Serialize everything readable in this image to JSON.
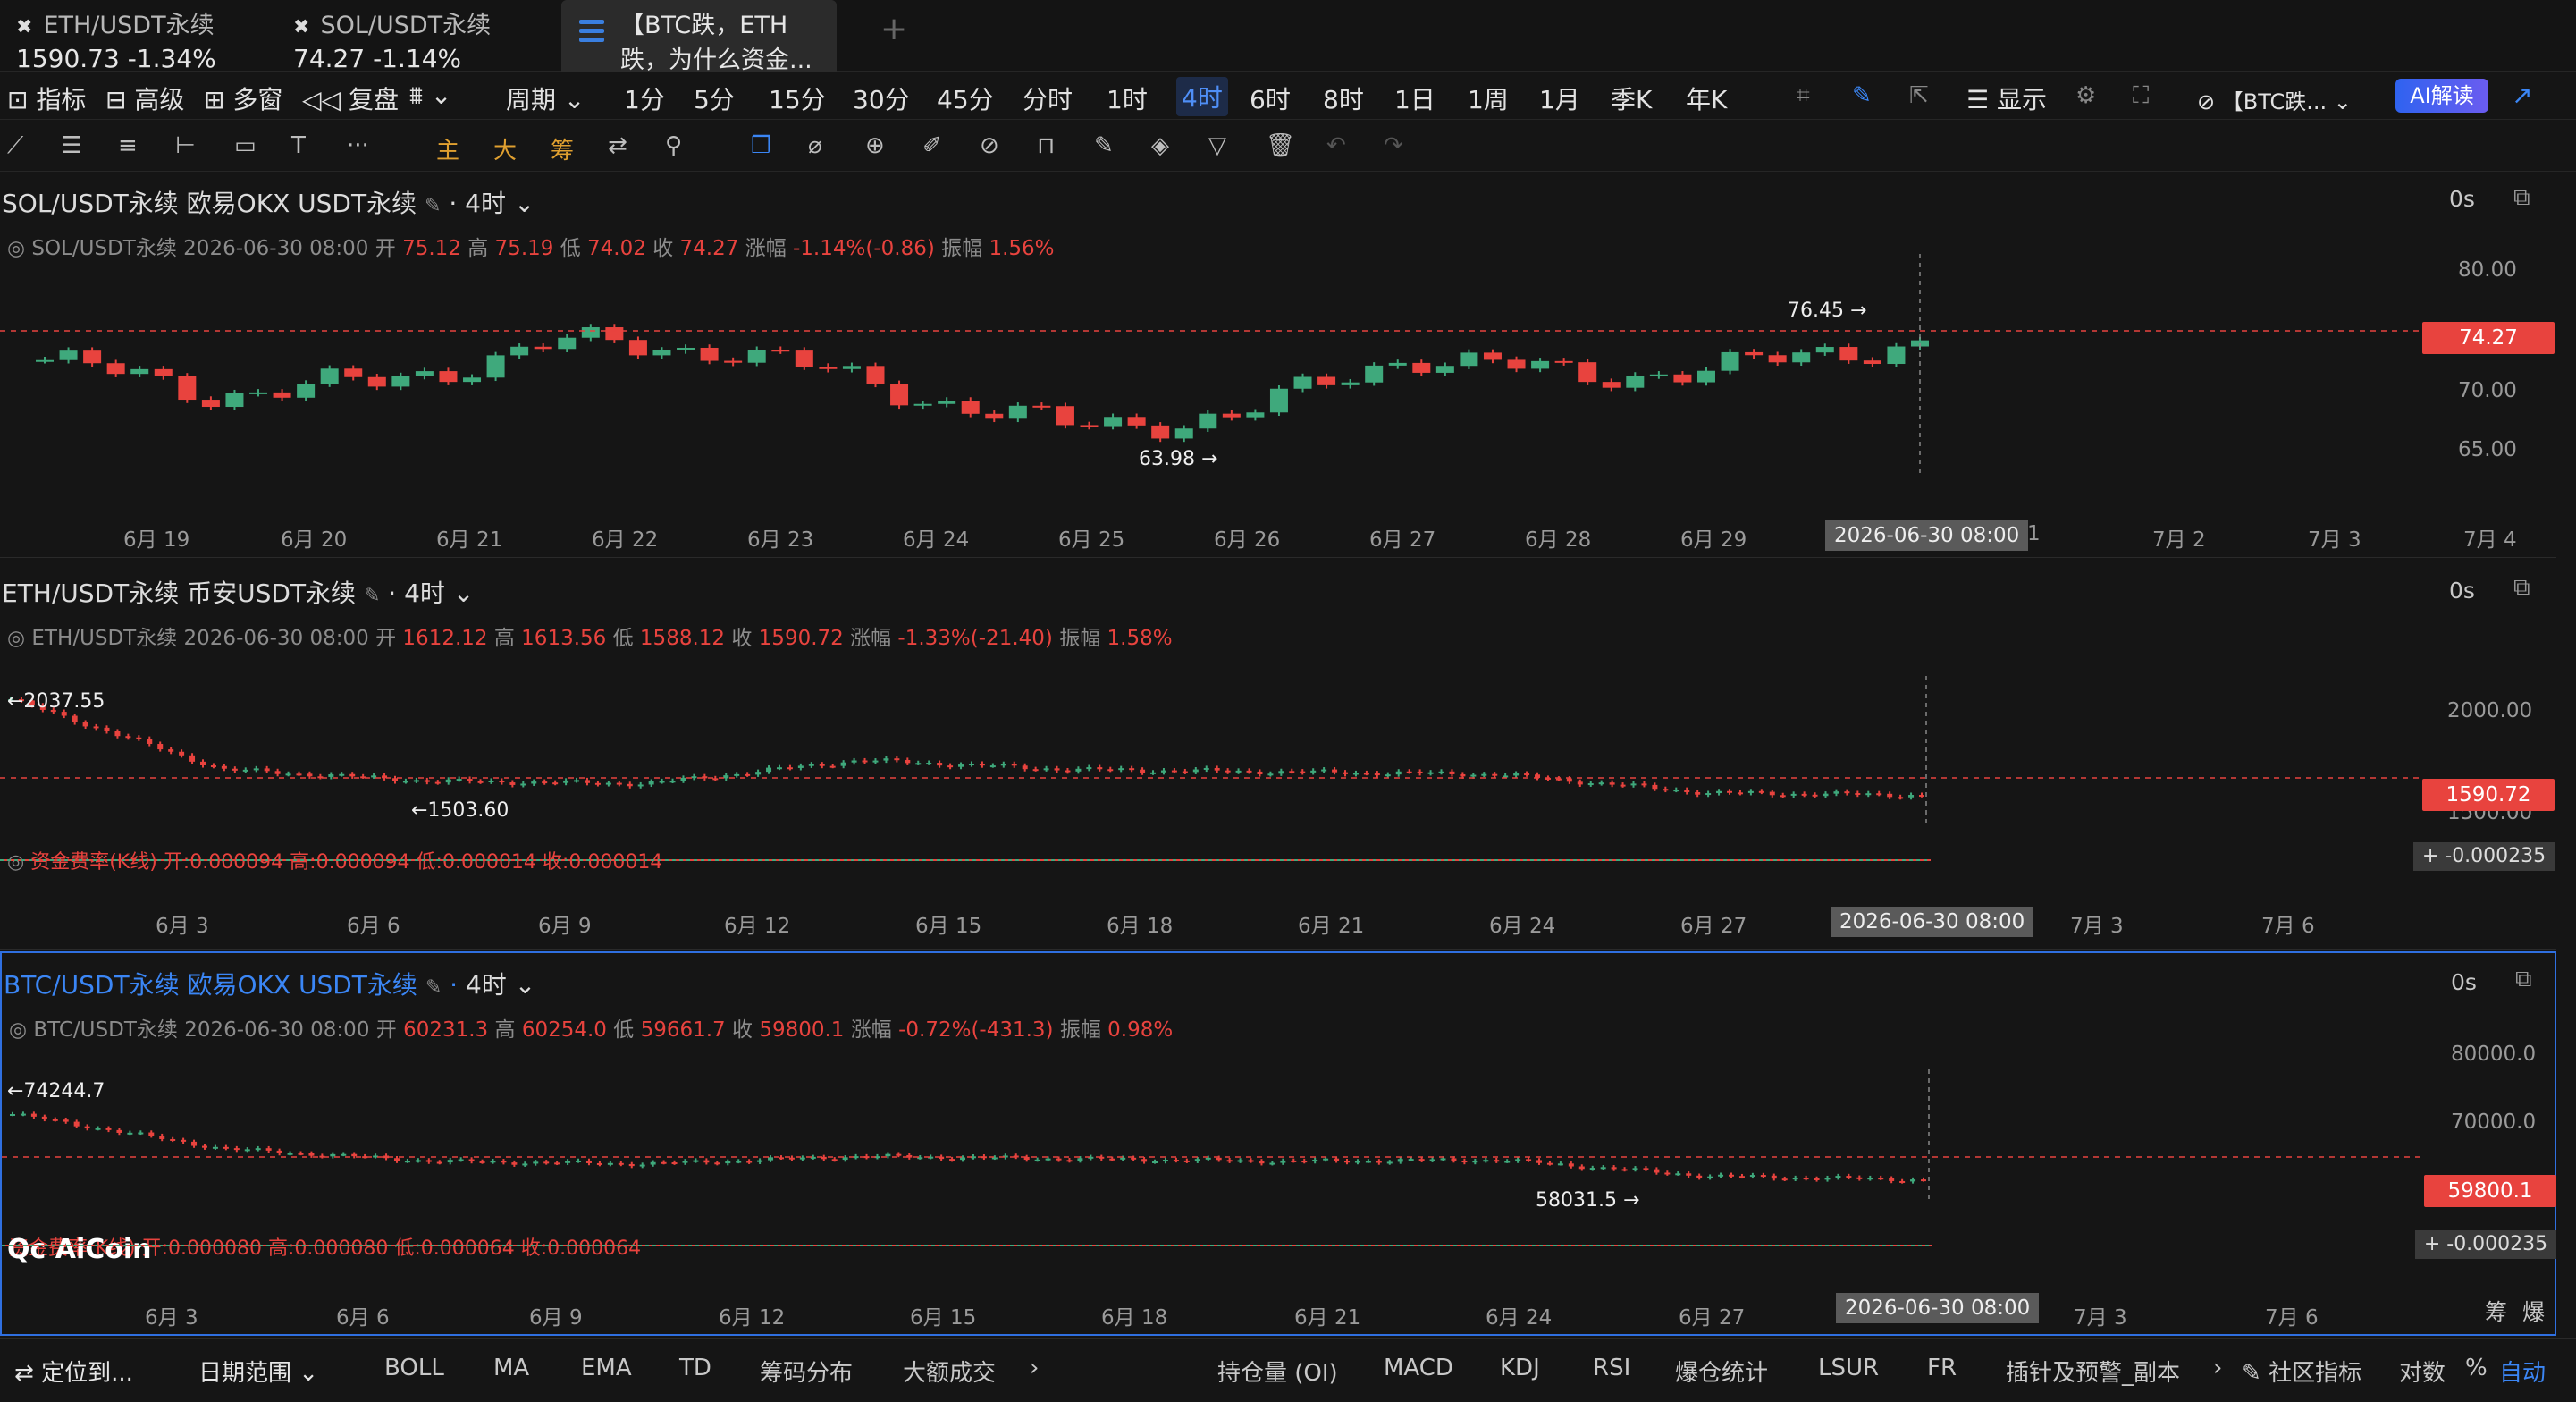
{
  "tabs": [
    {
      "symbol": "ETH/USDT永续",
      "price": "1590.73",
      "change": "-1.34%"
    },
    {
      "symbol": "SOL/USDT永续",
      "price": "74.27",
      "change": "-1.14%"
    },
    {
      "line1": "【BTC跌，ETH",
      "line2": "跌，为什么资金..."
    }
  ],
  "toolbar": {
    "indicators": "指标",
    "advanced": "高级",
    "multiwin": "多窗",
    "replay": "复盘",
    "period": "周期",
    "intervals": [
      "1分",
      "5分",
      "15分",
      "30分",
      "45分",
      "分时",
      "1时",
      "4时",
      "6时",
      "8时",
      "1日",
      "1周",
      "1月",
      "季K",
      "年K"
    ],
    "active_interval": "4时",
    "display": "显示",
    "news": "【BTC跌...",
    "ai": "AI解读"
  },
  "drawbar": {
    "main": "主",
    "big": "大",
    "chips": "筹"
  },
  "panels": {
    "sol": {
      "title": "SOL/USDT永续 欧易OKX USDT永续",
      "tf": "4时",
      "countdown": "0s",
      "info": {
        "sym": "SOL/USDT永续",
        "time": "2026-06-30 08:00",
        "open_l": "开",
        "open": "75.12",
        "high_l": "高",
        "high": "75.19",
        "low_l": "低",
        "low": "74.02",
        "close_l": "收",
        "close": "74.27",
        "chg_l": "涨幅",
        "chg": "-1.14%(-0.86)",
        "amp_l": "振幅",
        "amp": "1.56%"
      },
      "yticks": [
        "80.00",
        "70.00",
        "65.00"
      ],
      "last": "74.27",
      "hi_label": "76.45 →",
      "lo_label": "63.98 →",
      "xticks": [
        "6月 19",
        "6月 20",
        "6月 21",
        "6月 22",
        "6月 23",
        "6月 24",
        "6月 25",
        "6月 26",
        "6月 27",
        "6月 28",
        "6月 29",
        "1",
        "7月 2",
        "7月 3",
        "7月 4"
      ],
      "cursor": "2026-06-30 08:00",
      "chart_data": {
        "type": "candlestick",
        "x": [
          "6月 19",
          "6月 20",
          "6月 21",
          "6月 22",
          "6月 23",
          "6月 24",
          "6月 25",
          "6月 26",
          "6月 27",
          "6月 28",
          "6月 29",
          "2026-06-30"
        ],
        "close": [
          72.5,
          69.5,
          70.5,
          74.0,
          73.5,
          69.8,
          66.5,
          67.5,
          73.0,
          71.0,
          72.0,
          74.27
        ],
        "ylim": [
          62,
          82
        ]
      }
    },
    "eth": {
      "title": "ETH/USDT永续 币安USDT永续",
      "tf": "4时",
      "countdown": "0s",
      "info": {
        "sym": "ETH/USDT永续",
        "time": "2026-06-30 08:00",
        "open_l": "开",
        "open": "1612.12",
        "high_l": "高",
        "high": "1613.56",
        "low_l": "低",
        "low": "1588.12",
        "close_l": "收",
        "close": "1590.72",
        "chg_l": "涨幅",
        "chg": "-1.33%(-21.40)",
        "amp_l": "振幅",
        "amp": "1.58%"
      },
      "yticks": [
        "2000.00",
        "1500.00"
      ],
      "last": "1590.72",
      "hi_label": "←2037.55",
      "lo_label": "←1503.60",
      "funding": "资金费率(K线) 开:0.000094 高:0.000094 低:0.000014 收:0.000014",
      "funding_val": "-0.000235",
      "xticks": [
        "6月 3",
        "6月 6",
        "6月 9",
        "6月 12",
        "6月 15",
        "6月 18",
        "6月 21",
        "6月 24",
        "6月 27",
        "7月 3",
        "7月 6"
      ],
      "cursor": "2026-06-30 08:00",
      "chart_data": {
        "type": "candlestick",
        "x": [
          "6月 3",
          "6月 6",
          "6月 9",
          "6月 12",
          "6月 15",
          "6月 18",
          "6月 21",
          "6月 24",
          "6月 27",
          "2026-06-30"
        ],
        "close": [
          2000,
          1700,
          1650,
          1640,
          1740,
          1700,
          1690,
          1680,
          1600,
          1590.72
        ],
        "ylim": [
          1450,
          2100
        ]
      }
    },
    "btc": {
      "title": "BTC/USDT永续 欧易OKX USDT永续",
      "tf": "4时",
      "countdown": "0s",
      "info": {
        "sym": "BTC/USDT永续",
        "time": "2026-06-30 08:00",
        "open_l": "开",
        "open": "60231.3",
        "high_l": "高",
        "high": "60254.0",
        "low_l": "低",
        "low": "59661.7",
        "close_l": "收",
        "close": "59800.1",
        "chg_l": "涨幅",
        "chg": "-0.72%(-431.3)",
        "amp_l": "振幅",
        "amp": "0.98%"
      },
      "yticks": [
        "80000.0",
        "70000.0"
      ],
      "last": "59800.1",
      "hi_label": "←74244.7",
      "lo_label": "58031.5 →",
      "funding": "资金费率(K线) 开:0.000080 高:0.000080 低:0.000064 收:0.000064",
      "funding_val": "-0.000235",
      "xticks": [
        "6月 3",
        "6月 6",
        "6月 9",
        "6月 12",
        "6月 15",
        "6月 18",
        "6月 21",
        "6月 24",
        "6月 27",
        "7月 3",
        "7月 6"
      ],
      "cursor": "2026-06-30 08:00",
      "chips": "筹",
      "blast": "爆",
      "chart_data": {
        "type": "candlestick",
        "x": [
          "6月 3",
          "6月 6",
          "6月 9",
          "6月 12",
          "6月 15",
          "6月 18",
          "6月 21",
          "6月 24",
          "6月 27",
          "2026-06-30"
        ],
        "close": [
          73000,
          66000,
          63500,
          63000,
          64500,
          64000,
          63500,
          63800,
          60500,
          59800.1
        ],
        "ylim": [
          55000,
          82000
        ]
      }
    }
  },
  "logo": "AiCoin",
  "bottom": {
    "locate": "定位到...",
    "daterange": "日期范围",
    "left": [
      "BOLL",
      "MA",
      "EMA",
      "TD",
      "筹码分布",
      "大额成交"
    ],
    "right": [
      "持仓量 (OI)",
      "MACD",
      "KDJ",
      "RSI",
      "爆仓统计",
      "LSUR",
      "FR",
      "插针及预警_副本"
    ],
    "community": "社区指标",
    "log": "对数",
    "pct": "%",
    "auto": "自动"
  },
  "colors": {
    "up": "#3fa97c",
    "down": "#e8433e",
    "accent": "#3b86f5",
    "bg": "#151515"
  }
}
